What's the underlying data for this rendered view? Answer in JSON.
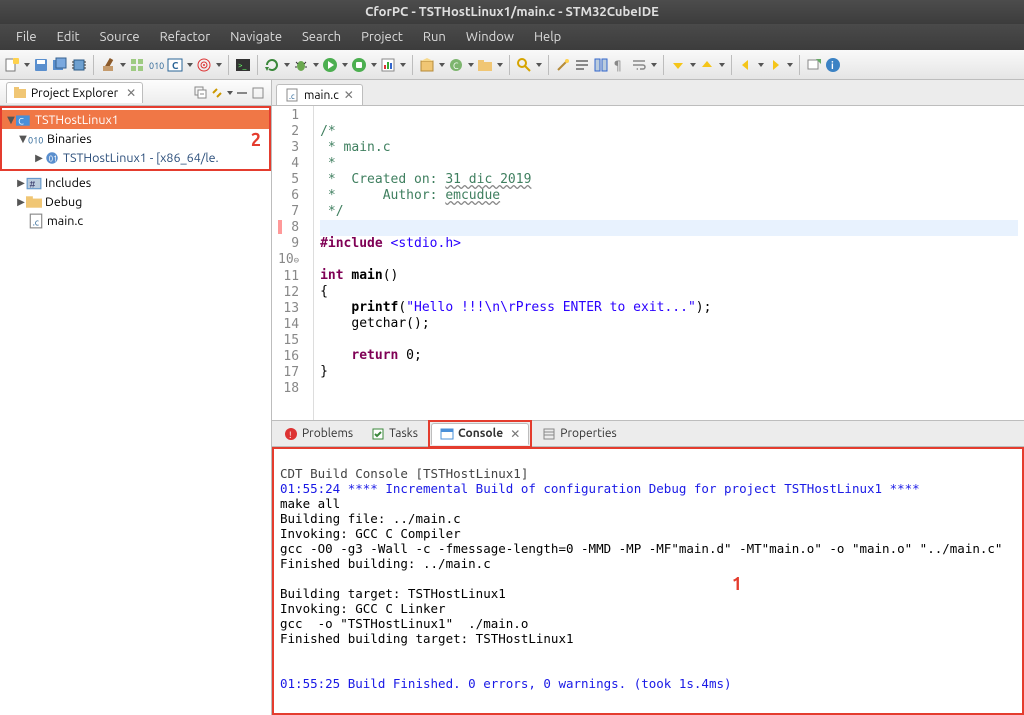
{
  "window": {
    "title": "CforPC - TSTHostLinux1/main.c - STM32CubeIDE"
  },
  "menu": [
    "File",
    "Edit",
    "Source",
    "Refactor",
    "Navigate",
    "Search",
    "Project",
    "Run",
    "Window",
    "Help"
  ],
  "project_explorer": {
    "title": "Project Explorer",
    "project": "TSTHostLinux1",
    "binaries_label": "Binaries",
    "binary_item": "TSTHostLinux1 - [x86_64/le.",
    "includes_label": "Includes",
    "debug_label": "Debug",
    "mainc_label": "main.c"
  },
  "editor": {
    "tab": "main.c",
    "lines": {
      "l1": "/*",
      "l2": " * main.c",
      "l3": " *",
      "l4a": " *  Created on: ",
      "l4b": "31 dic 2019",
      "l5a": " *      Author: ",
      "l5b": "emcudue",
      "l6": " */",
      "l7": " ",
      "l8a": "#include",
      "l8b": " <stdio.h>",
      "l9": " ",
      "l10a": "int",
      "l10b": " ",
      "l10c": "main",
      "l10d": "()",
      "l11": "{",
      "l12a": "    ",
      "l12b": "printf",
      "l12c": "(",
      "l12d": "\"Hello !!!\\n\\rPress ENTER to exit...\"",
      "l12e": ");",
      "l13a": "    getchar();",
      "l14": " ",
      "l15a": "    ",
      "l15b": "return",
      "l15c": " 0;",
      "l16": "}",
      "l17": " ",
      "l18": " "
    },
    "lineno": [
      "1",
      "2",
      "3",
      "4",
      "5",
      "6",
      "7",
      "8",
      "9",
      "10",
      "11",
      "12",
      "13",
      "14",
      "15",
      "16",
      "17",
      "18"
    ]
  },
  "bottom_tabs": {
    "problems": "Problems",
    "tasks": "Tasks",
    "console": "Console",
    "properties": "Properties"
  },
  "console": {
    "header": "CDT Build Console [TSTHostLinux1]",
    "line1": "01:55:24 **** Incremental Build of configuration Debug for project TSTHostLinux1 ****",
    "line2": "make all ",
    "line3": "Building file: ../main.c",
    "line4": "Invoking: GCC C Compiler",
    "line5": "gcc -O0 -g3 -Wall -c -fmessage-length=0 -MMD -MP -MF\"main.d\" -MT\"main.o\" -o \"main.o\" \"../main.c\"",
    "line6": "Finished building: ../main.c",
    "line7": " ",
    "line8": "Building target: TSTHostLinux1",
    "line9": "Invoking: GCC C Linker",
    "line10": "gcc  -o \"TSTHostLinux1\"  ./main.o   ",
    "line11": "Finished building target: TSTHostLinux1",
    "line12": " ",
    "line13": " ",
    "line14": "01:55:25 Build Finished. 0 errors, 0 warnings. (took 1s.4ms)"
  },
  "annotations": {
    "one": "1",
    "two": "2"
  }
}
